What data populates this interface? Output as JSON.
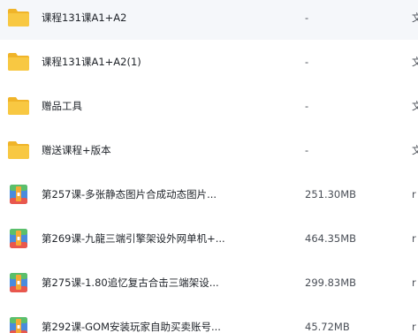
{
  "files": [
    {
      "name": "课程131课A1+A2",
      "size": "-",
      "type": "文",
      "icon": "folder-icon"
    },
    {
      "name": "课程131课A1+A2(1)",
      "size": "-",
      "type": "文",
      "icon": "folder-icon"
    },
    {
      "name": "赠品工具",
      "size": "-",
      "type": "文",
      "icon": "folder-icon"
    },
    {
      "name": "赠送课程+版本",
      "size": "-",
      "type": "文",
      "icon": "folder-icon"
    },
    {
      "name": "第257课-多张静态图片合成动态图片...",
      "size": "251.30MB",
      "type": "r",
      "icon": "archive-icon"
    },
    {
      "name": "第269课-九龍三端引擎架设外网单机+...",
      "size": "464.35MB",
      "type": "r",
      "icon": "archive-icon"
    },
    {
      "name": "第275课-1.80追忆复古合击三端架设...",
      "size": "299.83MB",
      "type": "r",
      "icon": "archive-icon"
    },
    {
      "name": "第292课-GOM安装玩家自助买卖账号...",
      "size": "45.72MB",
      "type": "r",
      "icon": "archive-icon"
    }
  ],
  "colors": {
    "folder": "#f8c842",
    "folder_tab": "#f0b429",
    "archive_blue": "#4a8bdc",
    "archive_green": "#5bbf6b",
    "archive_red": "#e9574d",
    "archive_orange": "#f6a935"
  }
}
